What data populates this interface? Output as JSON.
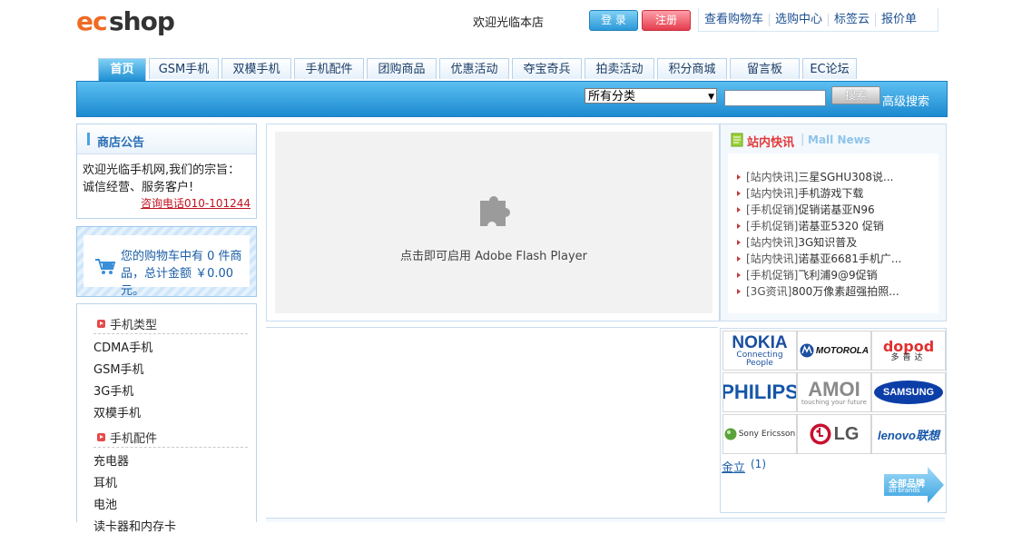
{
  "header": {
    "logo_text": "ecshop",
    "welcome": "欢迎光临本店",
    "login_label": "登 录",
    "register_label": "注册",
    "links": [
      "查看购物车",
      "选购中心",
      "标签云",
      "报价单"
    ]
  },
  "nav": {
    "tabs": [
      "首页",
      "GSM手机",
      "双模手机",
      "手机配件",
      "团购商品",
      "优惠活动",
      "夺宝奇兵",
      "拍卖活动",
      "积分商城",
      "留言板",
      "EC论坛"
    ],
    "active": "首页"
  },
  "search": {
    "category_selected": "所有分类",
    "query_value": "",
    "button_label": "搜索",
    "advanced_label": "高级搜索"
  },
  "notice": {
    "title": "商店公告",
    "text": "欢迎光临手机网,我们的宗旨：诚信经营、服务客户!",
    "tel": "咨询电话010-101244"
  },
  "cart": {
    "text": "您的购物车中有 0 件商品，总计金额 ￥0.00元。"
  },
  "categories": [
    {
      "name": "手机类型",
      "items": [
        "CDMA手机",
        "GSM手机",
        "3G手机",
        "双模手机"
      ]
    },
    {
      "name": "手机配件",
      "items": [
        "充电器",
        "耳机",
        "电池",
        "读卡器和内存卡"
      ]
    }
  ],
  "flash": {
    "label": "点击即可启用 Adobe Flash Player"
  },
  "news": {
    "title_cn": "站内快讯",
    "title_en": "Mall News",
    "items": [
      {
        "cat": "[站内快讯]",
        "title": "三星SGHU308说..."
      },
      {
        "cat": "[站内快讯]",
        "title": "手机游戏下载"
      },
      {
        "cat": "[手机促销]",
        "title": "促销诺基亚N96"
      },
      {
        "cat": "[手机促销]",
        "title": "诺基亚5320 促销"
      },
      {
        "cat": "[站内快讯]",
        "title": "3G知识普及"
      },
      {
        "cat": "[站内快讯]",
        "title": "诺基亚6681手机广..."
      },
      {
        "cat": "[手机促销]",
        "title": "飞利浦9@9促销"
      },
      {
        "cat": "[3G资讯]",
        "title": "800万像素超强拍照..."
      }
    ]
  },
  "brands": {
    "logos": [
      "NOKIA",
      "MOTOROLA",
      "多普达",
      "PHILIPS",
      "AMOI",
      "SAMSUNG",
      "Sony Ericsson",
      "LG",
      "lenovo联想"
    ],
    "jinli_label": "金立",
    "jinli_count": "(1)",
    "all_brands_cn": "全部品牌",
    "all_brands_en": "all brands"
  },
  "colors": {
    "accent_blue": "#1c8ad0",
    "link_blue": "#1b4f90",
    "red": "#c1121f"
  }
}
